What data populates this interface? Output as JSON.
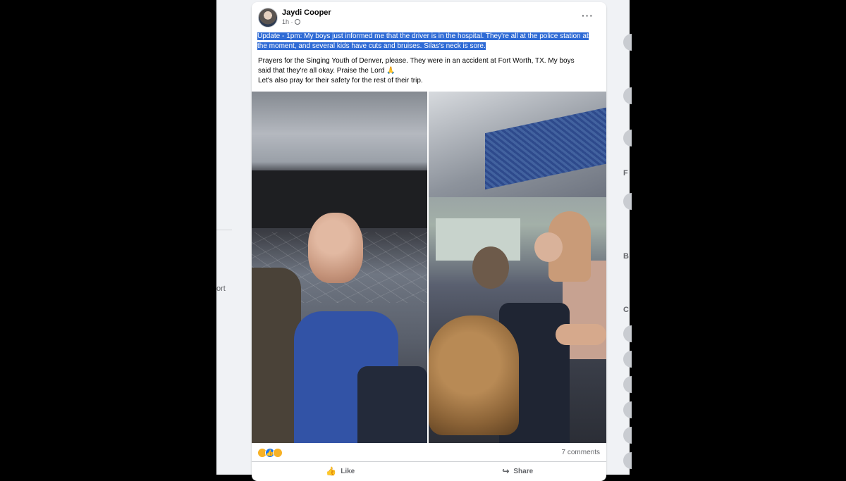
{
  "post": {
    "author": "Jaydi Cooper",
    "time": "1h ·",
    "more_icon": "more-horizontal-icon",
    "highlighted_text": "Update - 1pm: My boys just informed me that the driver is in the hospital. They're all at the police station at the moment, and several kids have cuts and bruises. Silas's neck is sore.",
    "body_lines": [
      "Prayers for the Singing Youth of Denver, please. They were in an accident at Fort Worth, TX. My boys",
      "said that they're all okay. Praise the Lord 🙏",
      "Let's also pray for their safety for the rest of their trip."
    ],
    "reactions": [
      "care",
      "like",
      "wow"
    ],
    "comments": "7 comments",
    "actions": {
      "like": "Like",
      "share": "Share"
    }
  },
  "left_fragment": "ort",
  "right_letters": [
    "F",
    "B",
    "C"
  ],
  "colors": {
    "highlight": "#2f6bd5",
    "like_blue": "#1877f2"
  }
}
